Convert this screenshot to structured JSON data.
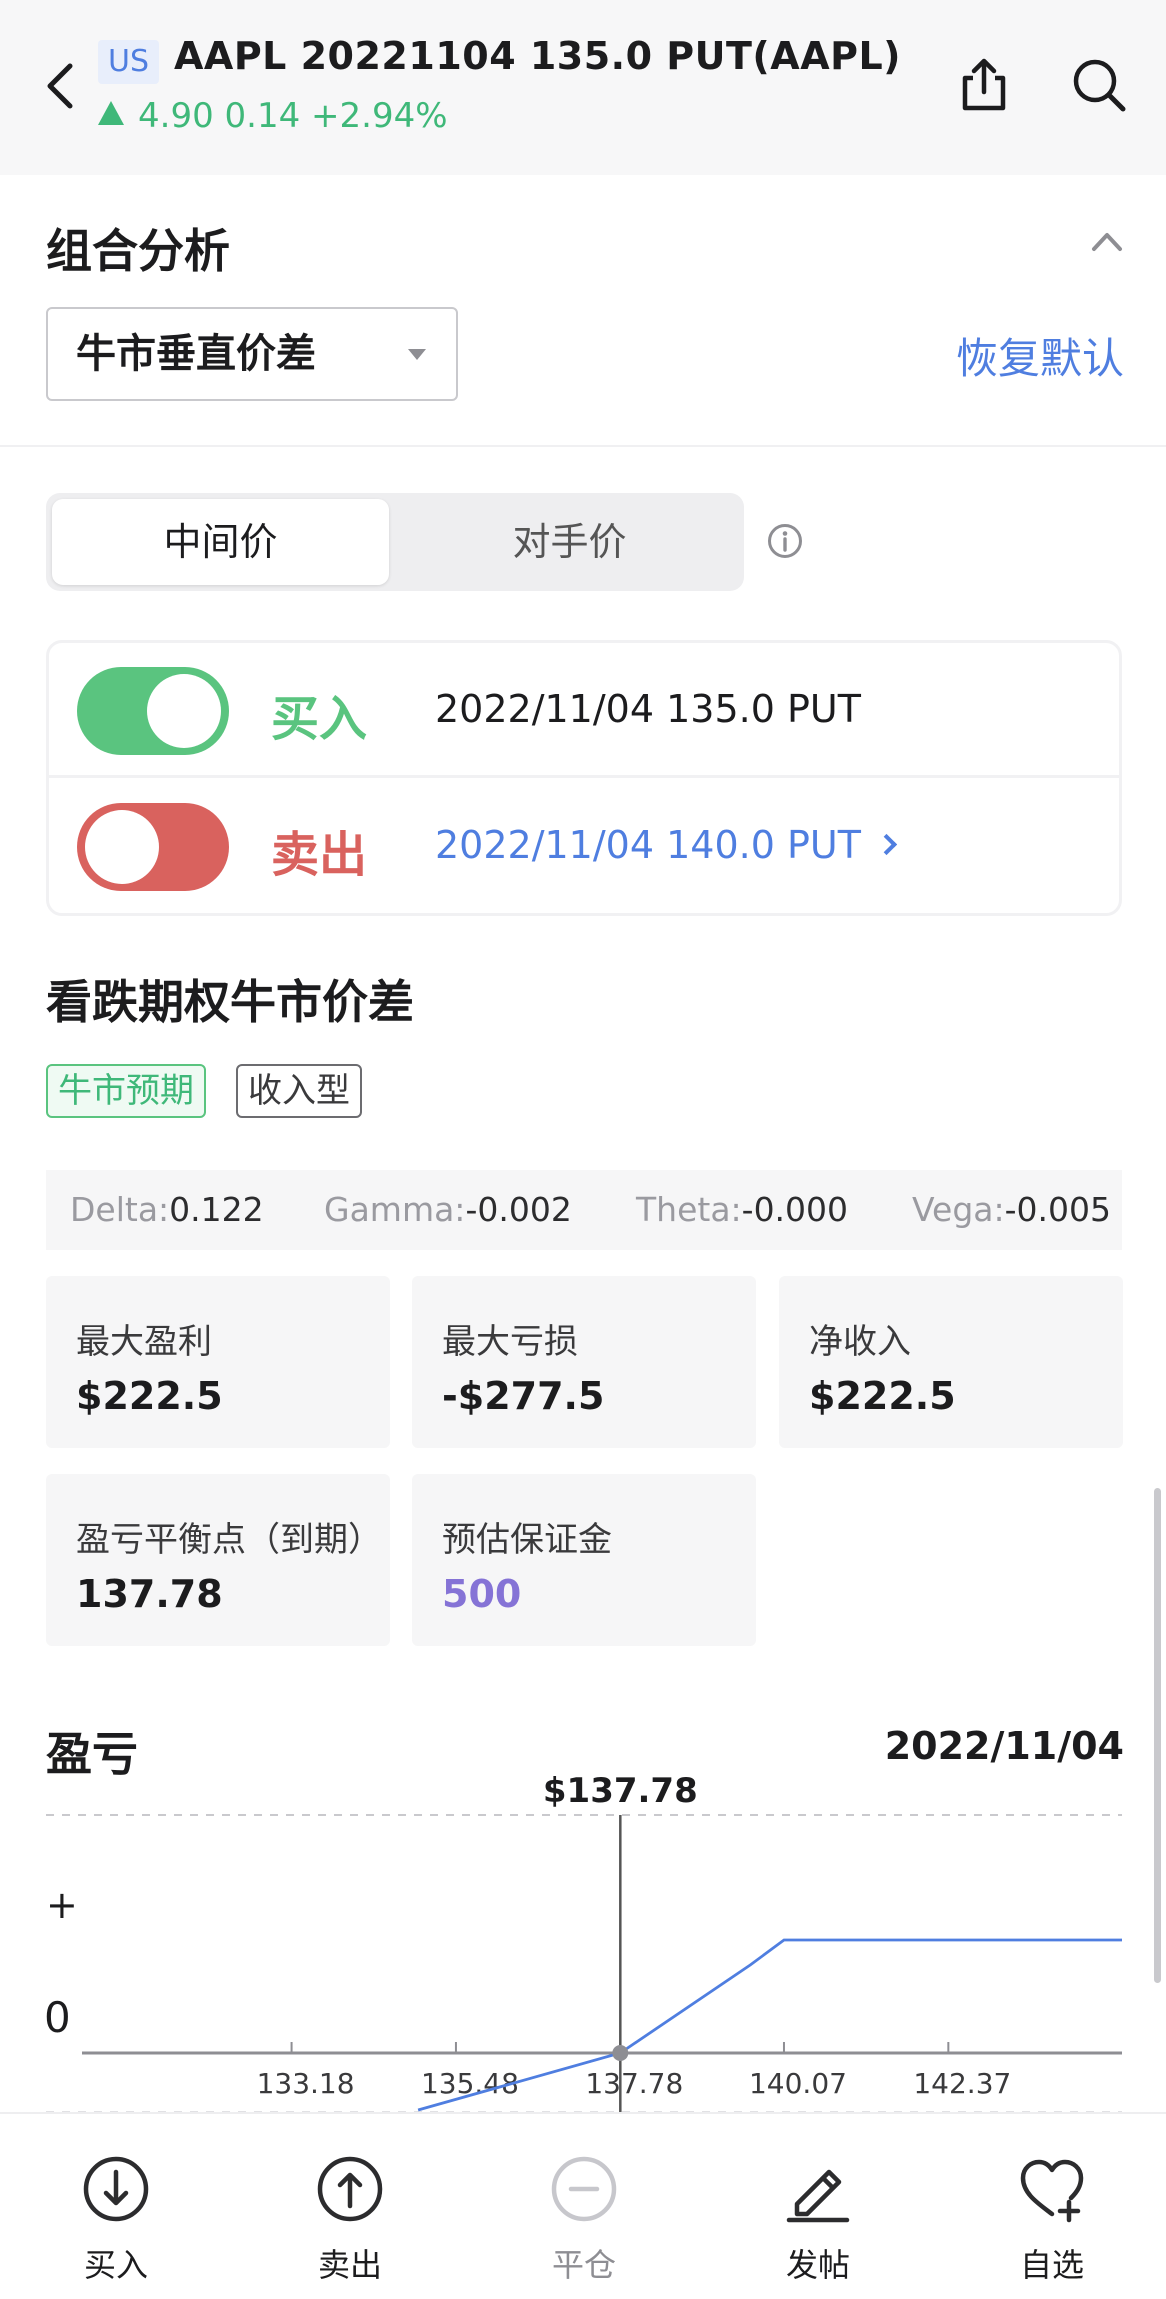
{
  "header": {
    "market_badge": "US",
    "title": "AAPL 20221104 135.0 PUT(AAPL)",
    "quote": "4.90 0.14 +2.94%",
    "icons": [
      "back-icon",
      "share-icon",
      "search-icon"
    ]
  },
  "analysis": {
    "section_title": "组合分析",
    "strategy_selected": "牛市垂直价差",
    "reset_label": "恢复默认"
  },
  "price_mode": {
    "options": [
      "中间价",
      "对手价"
    ],
    "selected": "中间价"
  },
  "legs": [
    {
      "side": "买入",
      "contract": "2022/11/04 135.0 PUT",
      "enabled": true
    },
    {
      "side": "卖出",
      "contract": "2022/11/04 140.0 PUT",
      "enabled": false
    }
  ],
  "strategy": {
    "name": "看跌期权牛市价差",
    "tags": [
      "牛市预期",
      "收入型"
    ]
  },
  "greeks": [
    {
      "label": "Delta:",
      "value": "0.122"
    },
    {
      "label": "Gamma:",
      "value": "-0.002"
    },
    {
      "label": "Theta:",
      "value": "-0.000"
    },
    {
      "label": "Vega:",
      "value": "-0.005"
    }
  ],
  "metrics": [
    {
      "label": "最大盈利",
      "value": "$222.5"
    },
    {
      "label": "最大亏损",
      "value": "-$277.5"
    },
    {
      "label": "净收入",
      "value": "$222.5"
    },
    {
      "label": "盈亏平衡点（到期）",
      "value": "137.78"
    },
    {
      "label": "预估保证金",
      "value": "500"
    }
  ],
  "pnl": {
    "title": "盈亏",
    "date": "2022/11/04",
    "marker_label": "$137.78",
    "y_plus_label": "+",
    "y_zero_label": "0"
  },
  "chart_data": {
    "type": "line",
    "title": "盈亏",
    "x_ticks": [
      "133.18",
      "135.48",
      "137.78",
      "140.07",
      "142.37"
    ],
    "x": [
      134.95,
      137.78,
      139.6,
      140.07,
      144.8
    ],
    "y": [
      -0.3,
      0.0,
      0.78,
      1.0,
      1.0
    ],
    "breakeven": 137.78,
    "xlim": [
      129.1,
      144.8
    ],
    "ylim": [
      -0.3,
      1.0
    ],
    "series_color": "#4f7ee0"
  },
  "bottom_nav": [
    {
      "label": "买入",
      "icon": "arrow-down-circle-icon"
    },
    {
      "label": "卖出",
      "icon": "arrow-up-circle-icon"
    },
    {
      "label": "平仓",
      "icon": "minus-circle-icon"
    },
    {
      "label": "发帖",
      "icon": "pencil-icon"
    },
    {
      "label": "自选",
      "icon": "heart-plus-icon"
    }
  ],
  "colors": {
    "accent": "#4f7ee0",
    "up": "#3fb879",
    "buy": "#5ac47f",
    "sell": "#d9625e",
    "margin": "#8573d6"
  }
}
